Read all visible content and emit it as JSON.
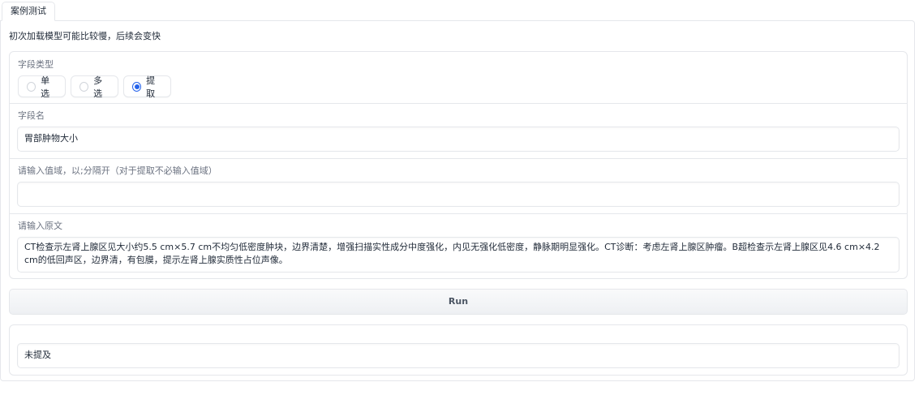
{
  "tabs": [
    {
      "label": "案例测试",
      "active": true
    }
  ],
  "hint": "初次加载模型可能比较慢，后续会变快",
  "field_type": {
    "label": "字段类型",
    "options": [
      {
        "label": "单选",
        "checked": false
      },
      {
        "label": "多选",
        "checked": false
      },
      {
        "label": "提取",
        "checked": true
      }
    ]
  },
  "field_name": {
    "label": "字段名",
    "value": "胃部肿物大小"
  },
  "value_range": {
    "label": "请输入值域，以;分隔开（对于提取不必输入值域）",
    "value": ""
  },
  "source_text": {
    "label": "请输入原文",
    "value": "CT检查示左肾上腺区见大小约5.5 cm×5.7 cm不均匀低密度肿块，边界清楚，增强扫描实性成分中度强化，内见无强化低密度，静脉期明显强化。CT诊断：考虑左肾上腺区肿瘤。B超检查示左肾上腺区见4.6 cm×4.2 cm的低回声区，边界清，有包膜，提示左肾上腺实质性占位声像。"
  },
  "run_button": {
    "label": "Run"
  },
  "output": {
    "value": "未提及"
  },
  "colors": {
    "accent": "#2563eb",
    "border": "#e5e7eb"
  }
}
